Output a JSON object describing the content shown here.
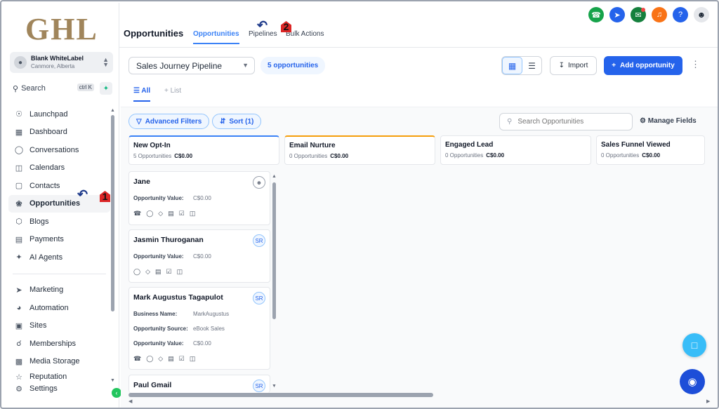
{
  "logo": "GHL",
  "account": {
    "name": "Blank WhiteLabel",
    "location": "Canmore, Alberta"
  },
  "search": {
    "label": "Search",
    "shortcut": "ctrl K"
  },
  "nav": {
    "items": [
      {
        "label": "Launchpad",
        "icon": "launchpad-icon"
      },
      {
        "label": "Dashboard",
        "icon": "dashboard-icon"
      },
      {
        "label": "Conversations",
        "icon": "chat-icon"
      },
      {
        "label": "Calendars",
        "icon": "calendar-icon"
      },
      {
        "label": "Contacts",
        "icon": "contacts-icon"
      },
      {
        "label": "Opportunities",
        "icon": "opportunities-icon",
        "active": true
      },
      {
        "label": "Blogs",
        "icon": "blogs-icon"
      },
      {
        "label": "Payments",
        "icon": "payments-icon"
      },
      {
        "label": "AI Agents",
        "icon": "ai-agents-icon"
      }
    ],
    "items2": [
      {
        "label": "Marketing",
        "icon": "marketing-icon"
      },
      {
        "label": "Automation",
        "icon": "automation-icon"
      },
      {
        "label": "Sites",
        "icon": "sites-icon"
      },
      {
        "label": "Memberships",
        "icon": "memberships-icon"
      },
      {
        "label": "Media Storage",
        "icon": "media-icon"
      },
      {
        "label": "Reputation",
        "icon": "reputation-icon"
      }
    ],
    "settings": "Settings"
  },
  "header": {
    "title": "Opportunities",
    "tabs": [
      "Opportunities",
      "Pipelines",
      "Bulk Actions"
    ]
  },
  "top_icons": [
    {
      "name": "phone-icon",
      "color": "#16a34a"
    },
    {
      "name": "rocket-icon",
      "color": "#2563eb"
    },
    {
      "name": "megaphone-icon",
      "color": "#15803d"
    },
    {
      "name": "bell-icon",
      "color": "#f97316"
    },
    {
      "name": "help-icon",
      "color": "#2563eb"
    }
  ],
  "toolbar": {
    "pipeline": "Sales Journey Pipeline",
    "count": "5 opportunities",
    "import": "Import",
    "add": "Add opportunity"
  },
  "subtabs": {
    "all": "All",
    "list": "List"
  },
  "filters": {
    "advanced": "Advanced Filters",
    "sort": "Sort (1)",
    "search_placeholder": "Search Opportunities",
    "manage": "Manage Fields"
  },
  "columns": [
    {
      "title": "New Opt-In",
      "count": "5 Opportunities",
      "value": "C$0.00",
      "accent": "#3b82f6"
    },
    {
      "title": "Email Nurture",
      "count": "0 Opportunities",
      "value": "C$0.00",
      "accent": "#f59e0b"
    },
    {
      "title": "Engaged Lead",
      "count": "0 Opportunities",
      "value": "C$0.00",
      "accent": "#e5e7eb"
    },
    {
      "title": "Sales Funnel Viewed",
      "count": "0 Opportunities",
      "value": "C$0.00",
      "accent": "#e5e7eb"
    }
  ],
  "cards": [
    {
      "name": "Jane",
      "badge": "",
      "fields": [
        {
          "k": "Opportunity Value:",
          "v": "C$0.00"
        }
      ]
    },
    {
      "name": "Jasmin Thuroganan",
      "badge": "SR",
      "fields": [
        {
          "k": "Opportunity Value:",
          "v": "C$0.00"
        }
      ]
    },
    {
      "name": "Mark Augustus Tagapulot",
      "badge": "SR",
      "fields": [
        {
          "k": "Business Name:",
          "v": "MarkAugustus"
        },
        {
          "k": "Opportunity Source:",
          "v": "eBook Sales"
        },
        {
          "k": "Opportunity Value:",
          "v": "C$0.00"
        }
      ]
    },
    {
      "name": "Paul Gmail",
      "badge": "SR",
      "fields": []
    }
  ],
  "annotations": {
    "one": "1",
    "two": "2"
  }
}
